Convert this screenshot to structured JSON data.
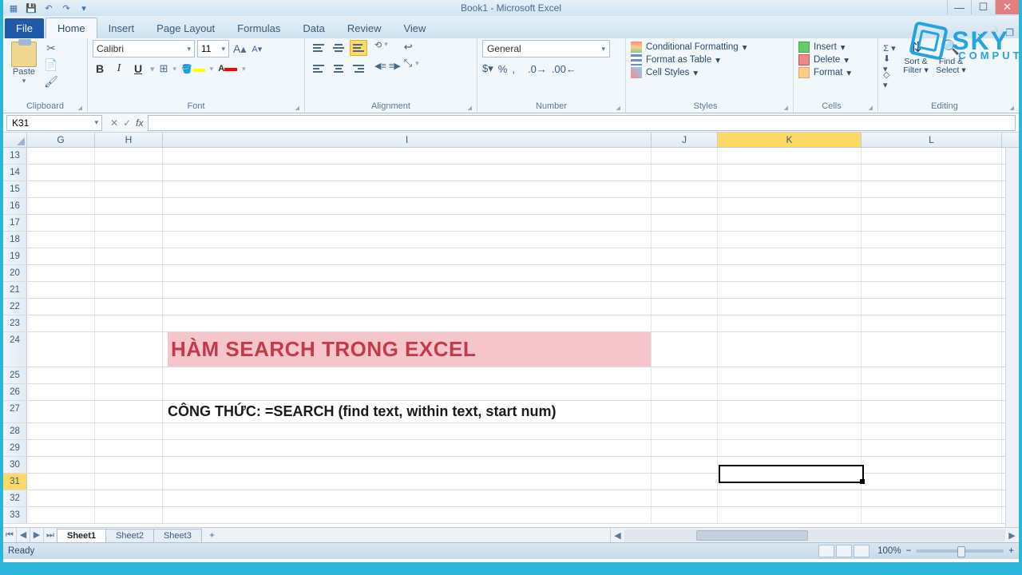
{
  "window": {
    "title": "Book1 - Microsoft Excel"
  },
  "ribbon": {
    "tabs": {
      "file": "File",
      "home": "Home",
      "insert": "Insert",
      "page_layout": "Page Layout",
      "formulas": "Formulas",
      "data": "Data",
      "review": "Review",
      "view": "View"
    },
    "groups": {
      "clipboard": {
        "label": "Clipboard",
        "paste": "Paste"
      },
      "font": {
        "label": "Font",
        "name": "Calibri",
        "size": "11"
      },
      "alignment": {
        "label": "Alignment"
      },
      "number": {
        "label": "Number",
        "format": "General"
      },
      "styles": {
        "label": "Styles",
        "conditional": "Conditional Formatting",
        "table": "Format as Table",
        "cell": "Cell Styles"
      },
      "cells": {
        "label": "Cells",
        "insert": "Insert",
        "delete": "Delete",
        "format": "Format"
      },
      "editing": {
        "label": "Editing",
        "sort": "Sort & Filter",
        "find": "Find & Select"
      }
    }
  },
  "formula_bar": {
    "name_box": "K31",
    "fx": "fx"
  },
  "columns": [
    "G",
    "H",
    "I",
    "J",
    "K",
    "L"
  ],
  "col_widths": {
    "G": 85,
    "H": 85,
    "I": 612,
    "J": 83,
    "K": 180,
    "L": 176
  },
  "selected_col": "K",
  "rows_visible": [
    13,
    14,
    15,
    16,
    17,
    18,
    19,
    20,
    21,
    22,
    23,
    24,
    25,
    26,
    27,
    28,
    29,
    30,
    31,
    32,
    33
  ],
  "selected_row": 31,
  "cells": {
    "I24": "HÀM SEARCH TRONG EXCEL",
    "I27": "CÔNG THỨC: =SEARCH (find text, within text, start num)"
  },
  "active_cell": "K31",
  "sheets": {
    "active": "Sheet1",
    "list": [
      "Sheet1",
      "Sheet2",
      "Sheet3"
    ]
  },
  "status": {
    "ready": "Ready",
    "zoom": "100%"
  },
  "watermark": {
    "line1": "SKY",
    "line2": "COMPUTER"
  }
}
